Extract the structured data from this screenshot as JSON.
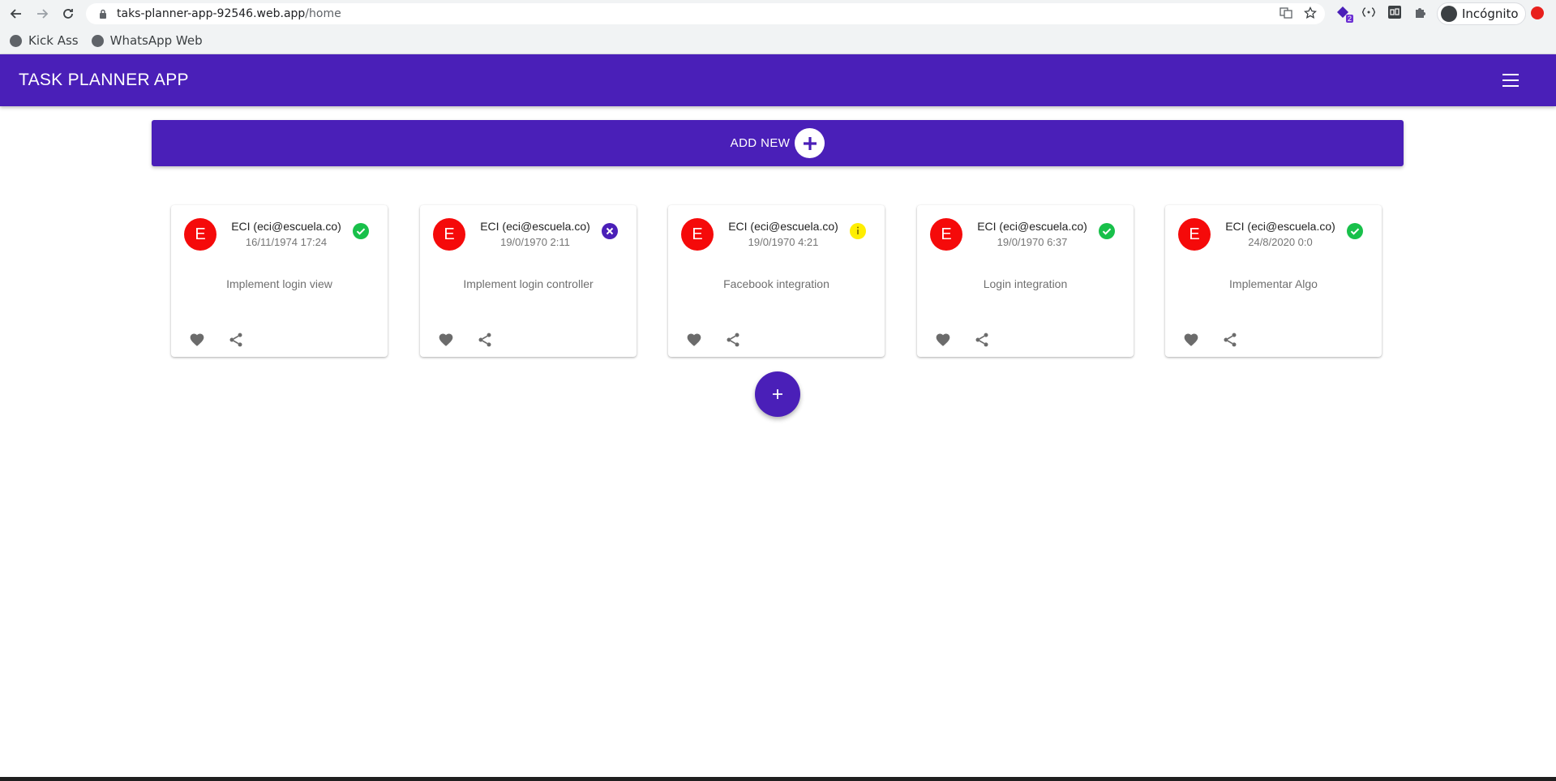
{
  "browser": {
    "url_host": "taks-planner-app-92546.web.app",
    "url_path": "/home",
    "profile_label": "Incógnito",
    "extension_badge": "2",
    "bookmarks": [
      {
        "label": "Kick Ass"
      },
      {
        "label": "WhatsApp Web"
      }
    ]
  },
  "appbar": {
    "title": "TASK PLANNER APP"
  },
  "add_new": {
    "label": "ADD NEW"
  },
  "cards": [
    {
      "avatar": "E",
      "title": "ECI (eci@escuela.co)",
      "date": "16/11/1974 17:24",
      "status": "done",
      "status_color": "#18c04a",
      "description": "Implement login view"
    },
    {
      "avatar": "E",
      "title": "ECI (eci@escuela.co)",
      "date": "19/0/1970 2:11",
      "status": "cancelled",
      "status_color": "#4a1fb8",
      "description": "Implement login controller"
    },
    {
      "avatar": "E",
      "title": "ECI (eci@escuela.co)",
      "date": "19/0/1970 4:21",
      "status": "in-progress",
      "status_color": "#ffee00",
      "description": "Facebook integration"
    },
    {
      "avatar": "E",
      "title": "ECI (eci@escuela.co)",
      "date": "19/0/1970 6:37",
      "status": "done",
      "status_color": "#18c04a",
      "description": "Login integration"
    },
    {
      "avatar": "E",
      "title": "ECI (eci@escuela.co)",
      "date": "24/8/2020 0:0",
      "status": "done",
      "status_color": "#18c04a",
      "description": "Implementar Algo"
    }
  ],
  "colors": {
    "primary": "#4a1fb8",
    "avatar": "#f50a0a",
    "status_done": "#18c04a",
    "status_in_progress": "#ffee00"
  }
}
